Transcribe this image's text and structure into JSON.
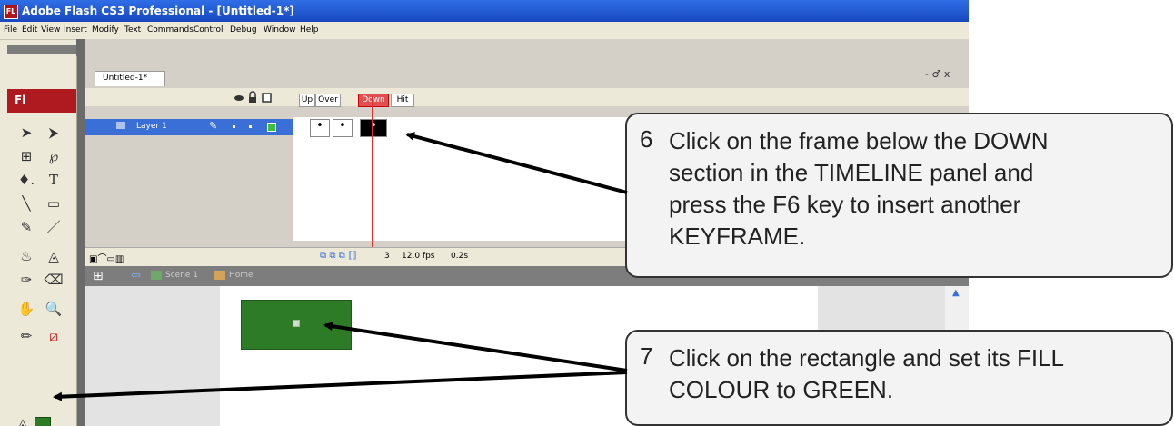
{
  "window": {
    "app_icon": "FL",
    "title": "Adobe Flash CS3 Professional - [Untitled-1*]"
  },
  "menubar": [
    "File",
    "Edit",
    "View",
    "Insert",
    "Modify",
    "Text",
    "Commands",
    "Control",
    "Debug",
    "Window",
    "Help"
  ],
  "toolbox": {
    "logo": "Fl",
    "tools": [
      "selection-tool",
      "subselection-tool",
      "free-transform-tool",
      "lasso-tool",
      "pen-tool",
      "text-tool",
      "line-tool",
      "rectangle-tool",
      "pencil-tool",
      "brush-tool",
      "ink-bottle-tool",
      "paint-bucket-tool",
      "eyedropper-tool",
      "eraser-tool",
      "hand-tool",
      "zoom-tool",
      "stroke-color-tool",
      "swap-colors-tool",
      "fill-color-tool"
    ],
    "pen_glyph": "♦.",
    "text_glyph": "T",
    "zoom_glyph": "🔍",
    "fill_color": "#2d7a27"
  },
  "document": {
    "tab_label": "Untitled-1*",
    "window_controls": "- ♂ x"
  },
  "timeline": {
    "frame_headers": [
      "Up",
      "Over",
      "Down",
      "Hit"
    ],
    "layer_name": "Layer 1",
    "frame_number": "3",
    "fps": "12.0 fps",
    "time": "0.2s",
    "keyframe_mark": "•"
  },
  "edit_bar": {
    "scene": "Scene 1",
    "symbol": "Home"
  },
  "stage": {
    "rectangle_fill": "#2d7a27"
  },
  "callouts": [
    {
      "number": "6",
      "text": "Click on the frame below the DOWN\nsection in the TIMELINE panel and\npress the F6 key to insert another\nKEYFRAME."
    },
    {
      "number": "7",
      "text": "Click on the rectangle and set its FILL\nCOLOUR to GREEN."
    }
  ]
}
